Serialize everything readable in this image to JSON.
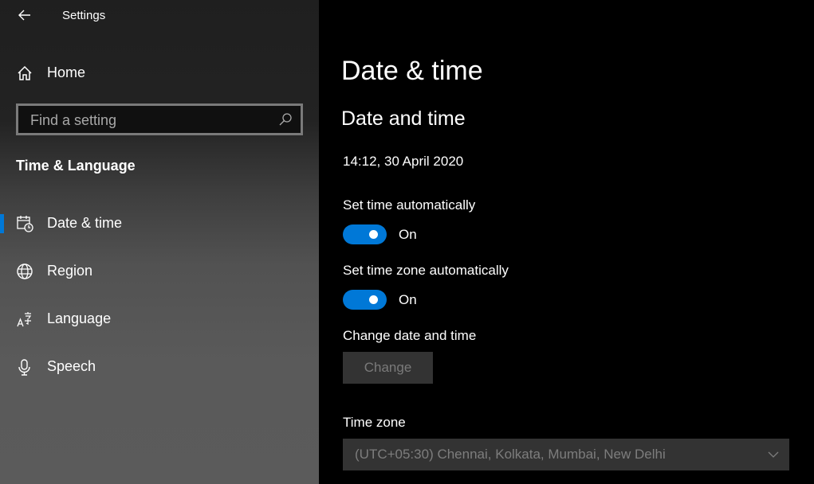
{
  "window": {
    "app_title": "Settings"
  },
  "sidebar": {
    "home_label": "Home",
    "search": {
      "placeholder": "Find a setting",
      "value": ""
    },
    "section_title": "Time & Language",
    "items": [
      {
        "label": "Date & time",
        "icon": "calendar-clock-icon",
        "selected": true
      },
      {
        "label": "Region",
        "icon": "globe-icon",
        "selected": false
      },
      {
        "label": "Language",
        "icon": "language-icon",
        "selected": false
      },
      {
        "label": "Speech",
        "icon": "microphone-icon",
        "selected": false
      }
    ],
    "accent_color": "#0078d7"
  },
  "main": {
    "page_title": "Date & time",
    "section_title": "Date and time",
    "current_datetime": "14:12, 30 April 2020",
    "set_time_auto": {
      "label": "Set time automatically",
      "state": "On",
      "on": true
    },
    "set_timezone_auto": {
      "label": "Set time zone automatically",
      "state": "On",
      "on": true
    },
    "change_datetime": {
      "label": "Change date and time",
      "button_label": "Change",
      "enabled": false
    },
    "time_zone": {
      "label": "Time zone",
      "selected": "(UTC+05:30) Chennai, Kolkata, Mumbai, New Delhi",
      "enabled": false
    }
  }
}
